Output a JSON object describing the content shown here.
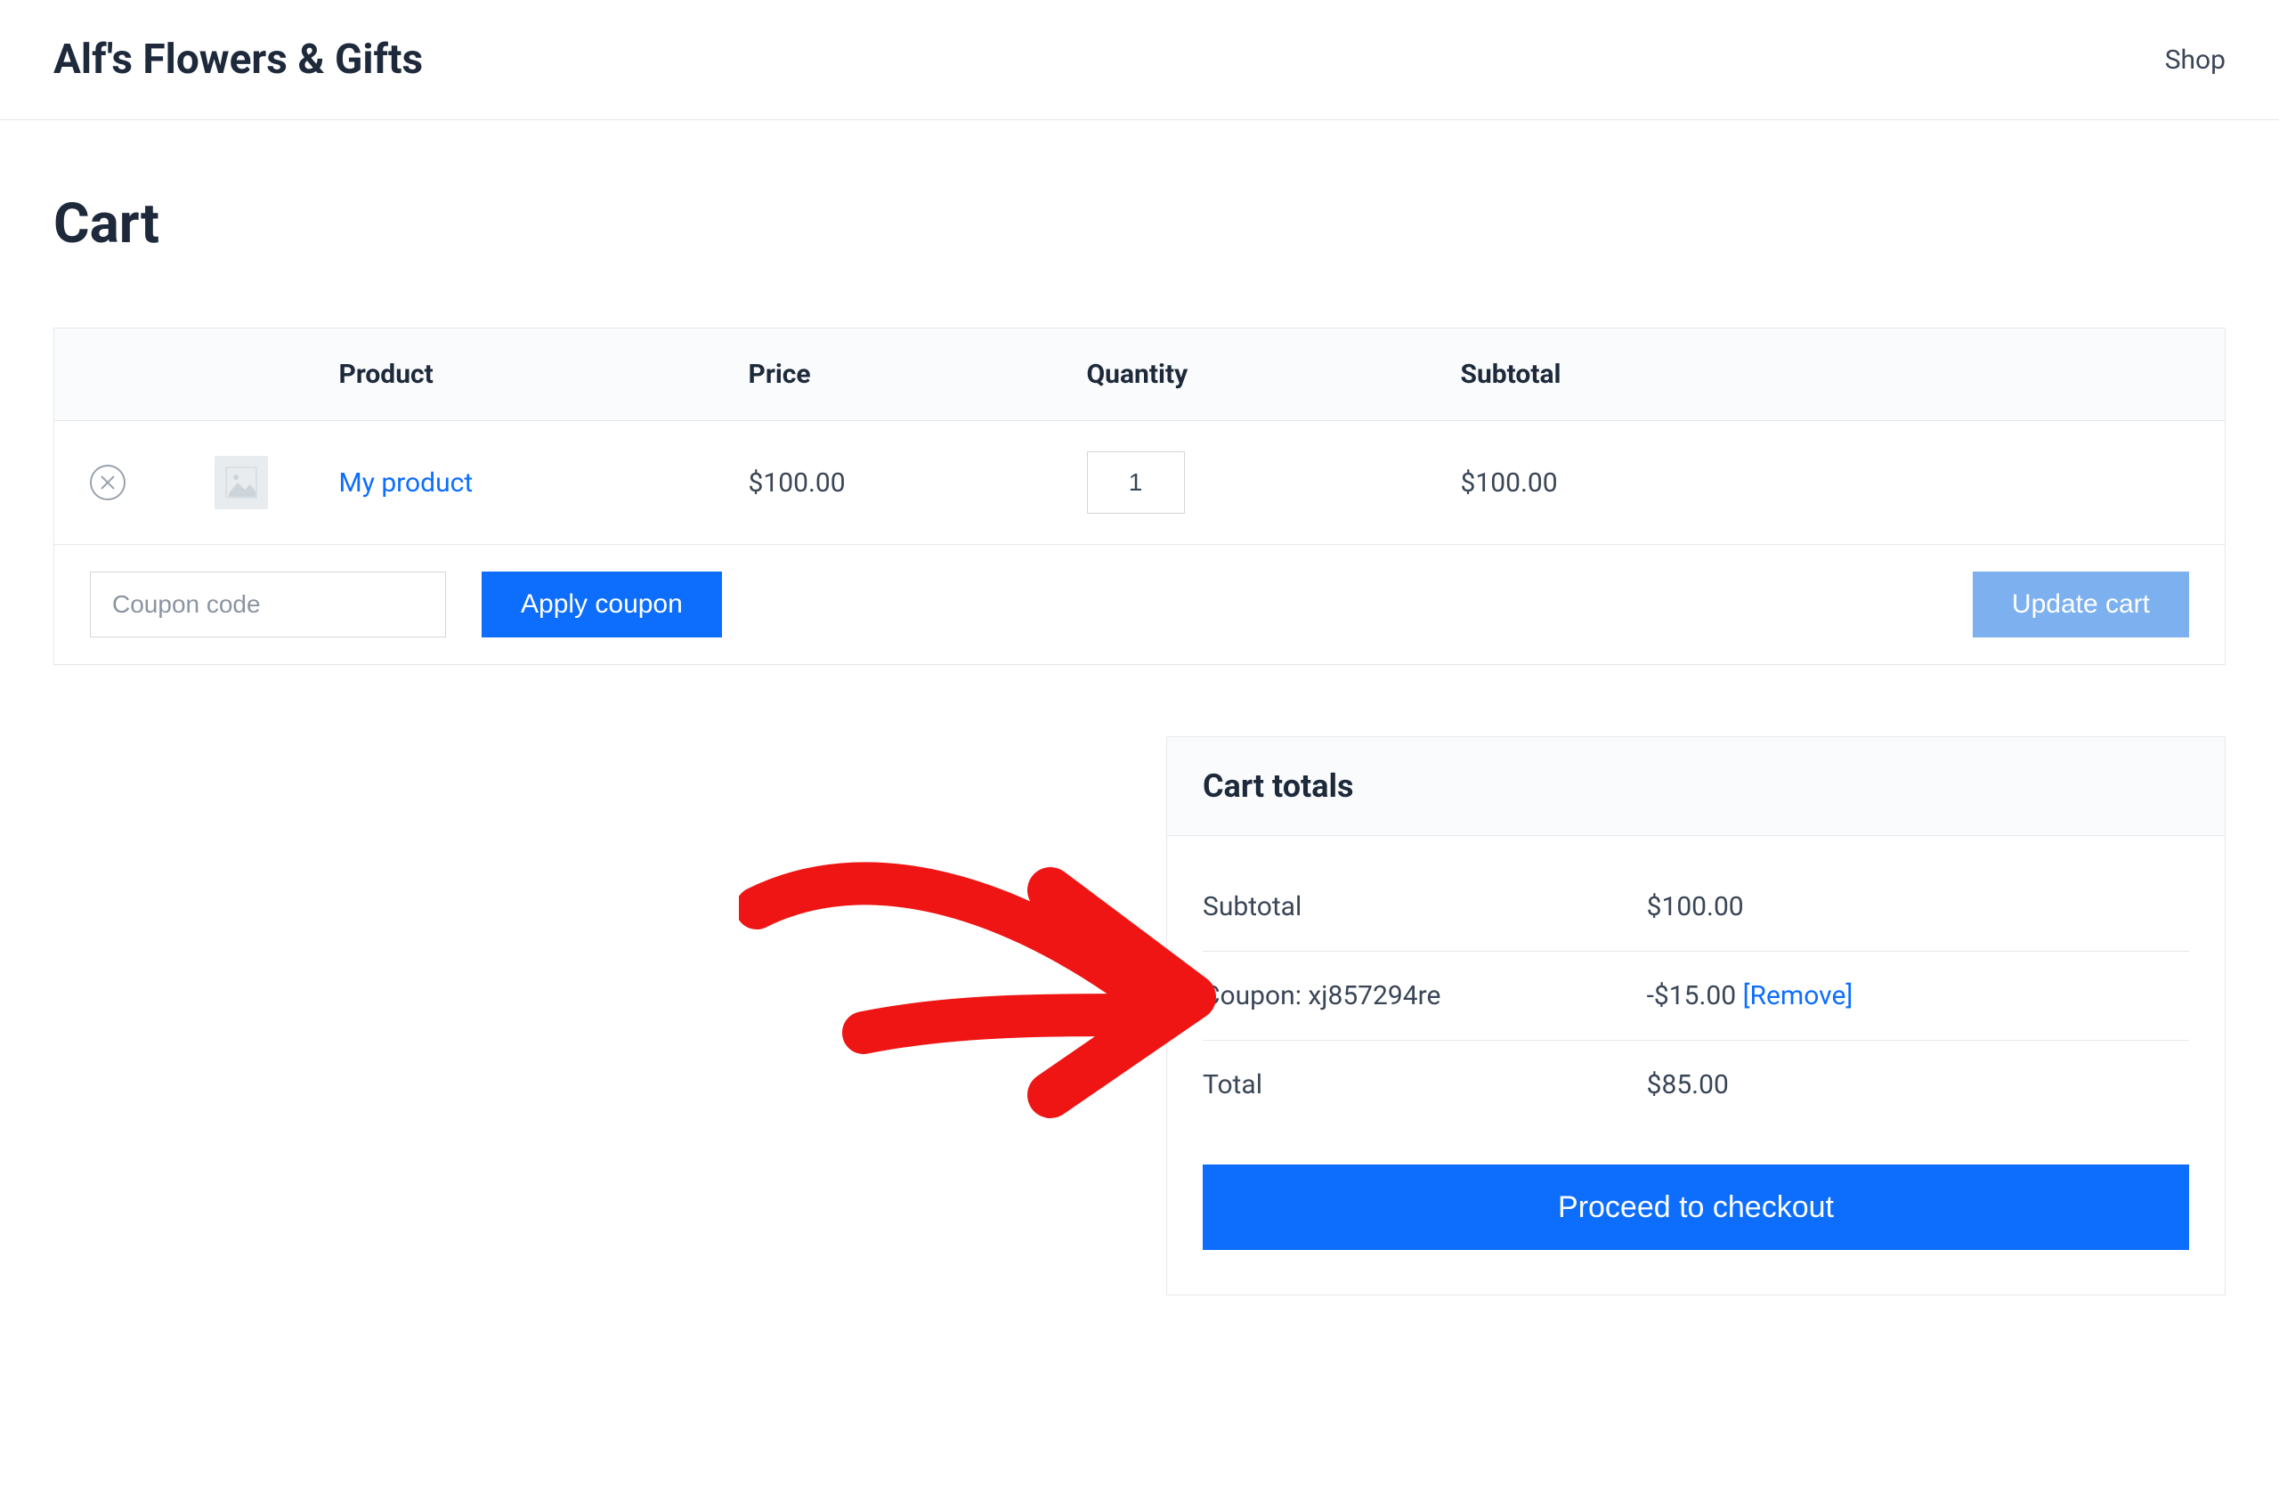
{
  "header": {
    "site_title": "Alf's Flowers & Gifts",
    "nav_shop": "Shop"
  },
  "page": {
    "title": "Cart"
  },
  "cart_table": {
    "headers": {
      "product": "Product",
      "price": "Price",
      "quantity": "Quantity",
      "subtotal": "Subtotal"
    },
    "item": {
      "name": "My product",
      "price": "$100.00",
      "quantity": "1",
      "subtotal": "$100.00"
    },
    "coupon_placeholder": "Coupon code",
    "apply_coupon_label": "Apply coupon",
    "update_cart_label": "Update cart"
  },
  "totals": {
    "title": "Cart totals",
    "subtotal_label": "Subtotal",
    "subtotal_value": "$100.00",
    "coupon_label": "Coupon: xj857294re",
    "coupon_value": "-$15.00",
    "remove_label": "[Remove]",
    "total_label": "Total",
    "total_value": "$85.00",
    "checkout_label": "Proceed to checkout"
  }
}
